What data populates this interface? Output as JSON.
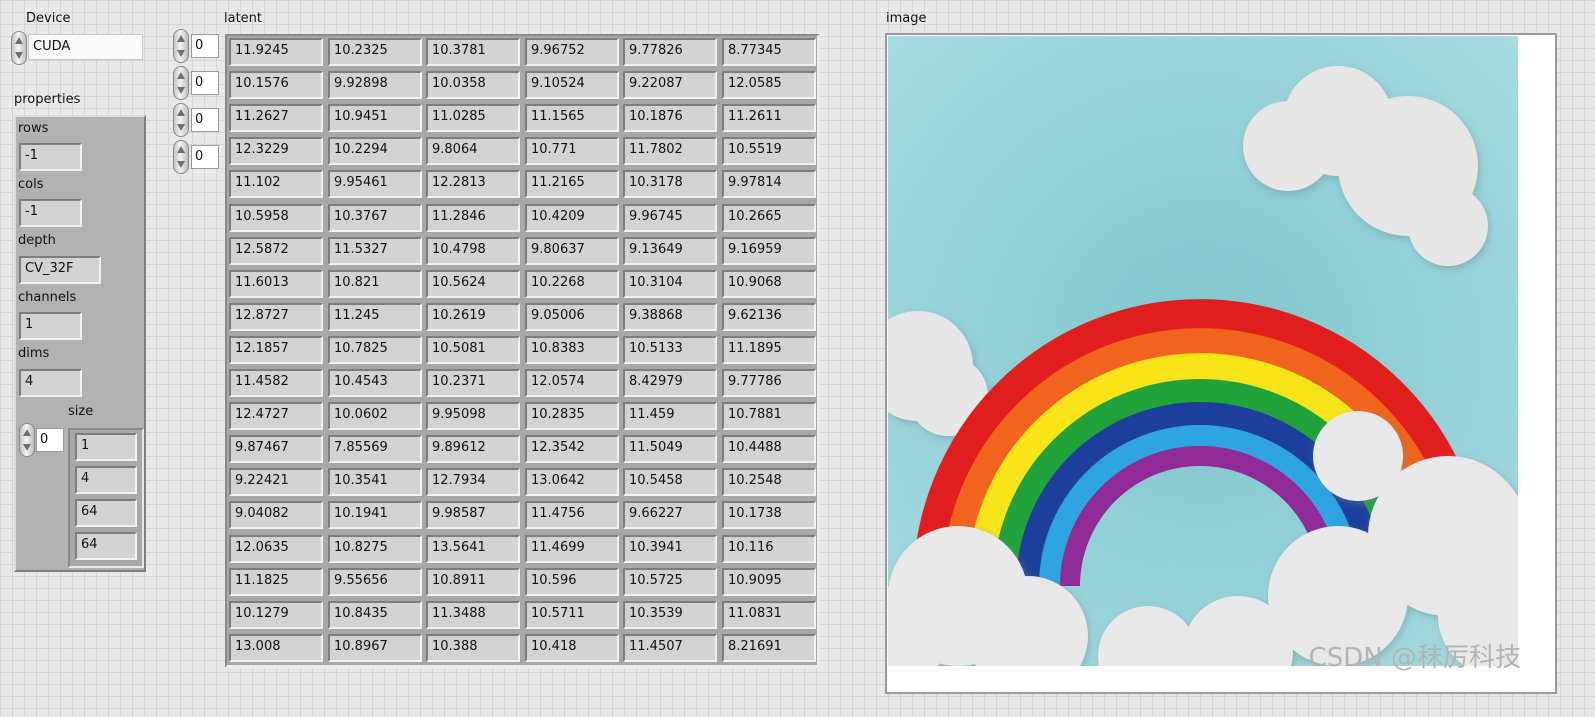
{
  "device": {
    "label": "Device",
    "value": "CUDA"
  },
  "properties": {
    "label": "properties",
    "rows": {
      "label": "rows",
      "value": "-1"
    },
    "cols": {
      "label": "cols",
      "value": "-1"
    },
    "depth": {
      "label": "depth",
      "value": "CV_32F"
    },
    "channels": {
      "label": "channels",
      "value": "1"
    },
    "dims": {
      "label": "dims",
      "value": "4"
    },
    "size": {
      "label": "size",
      "index": "0",
      "values": [
        "1",
        "4",
        "64",
        "64"
      ]
    }
  },
  "latent": {
    "label": "latent",
    "indices": [
      "0",
      "0",
      "0",
      "0"
    ],
    "rows": [
      [
        "11.9245",
        "10.2325",
        "10.3781",
        "9.96752",
        "9.77826",
        "8.77345"
      ],
      [
        "10.1576",
        "9.92898",
        "10.0358",
        "9.10524",
        "9.22087",
        "12.0585"
      ],
      [
        "11.2627",
        "10.9451",
        "11.0285",
        "11.1565",
        "10.1876",
        "11.2611"
      ],
      [
        "12.3229",
        "10.2294",
        "9.8064",
        "10.771",
        "11.7802",
        "10.5519"
      ],
      [
        "11.102",
        "9.95461",
        "12.2813",
        "11.2165",
        "10.3178",
        "9.97814"
      ],
      [
        "10.5958",
        "10.3767",
        "11.2846",
        "10.4209",
        "9.96745",
        "10.2665"
      ],
      [
        "12.5872",
        "11.5327",
        "10.4798",
        "9.80637",
        "9.13649",
        "9.16959"
      ],
      [
        "11.6013",
        "10.821",
        "10.5624",
        "10.2268",
        "10.3104",
        "10.9068"
      ],
      [
        "12.8727",
        "11.245",
        "10.2619",
        "9.05006",
        "9.38868",
        "9.62136"
      ],
      [
        "12.1857",
        "10.7825",
        "10.5081",
        "10.8383",
        "10.5133",
        "11.1895"
      ],
      [
        "11.4582",
        "10.4543",
        "10.2371",
        "12.0574",
        "8.42979",
        "9.77786"
      ],
      [
        "12.4727",
        "10.0602",
        "9.95098",
        "10.2835",
        "11.459",
        "10.7881"
      ],
      [
        "9.87467",
        "7.85569",
        "9.89612",
        "12.3542",
        "11.5049",
        "10.4488"
      ],
      [
        "9.22421",
        "10.3541",
        "12.7934",
        "13.0642",
        "10.5458",
        "10.2548"
      ],
      [
        "9.04082",
        "10.1941",
        "9.98587",
        "11.4756",
        "9.66227",
        "10.1738"
      ],
      [
        "12.0635",
        "10.8275",
        "13.5641",
        "11.4699",
        "10.3941",
        "10.116"
      ],
      [
        "11.1825",
        "9.55656",
        "10.8911",
        "10.596",
        "10.5725",
        "10.9095"
      ],
      [
        "10.1279",
        "10.8435",
        "11.3488",
        "10.5711",
        "10.3539",
        "11.0831"
      ],
      [
        "13.008",
        "10.8967",
        "10.388",
        "10.418",
        "11.4507",
        "8.21691"
      ]
    ]
  },
  "image": {
    "label": "image",
    "watermark": "CSDN @秣厉科技"
  }
}
